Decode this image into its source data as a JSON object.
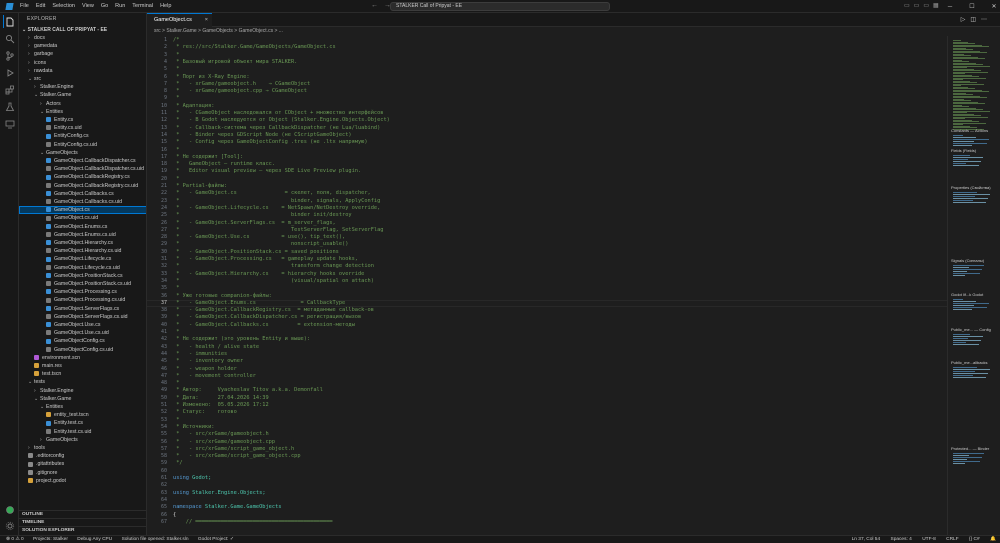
{
  "titlebar": {
    "menu": [
      "File",
      "Edit",
      "Selection",
      "View",
      "Go",
      "Run",
      "Terminal",
      "Help"
    ],
    "search": "STALKER Call of Pripyat - EE"
  },
  "sidebar": {
    "header": "EXPLORER",
    "project": "STALKER CALL OF PRIPYAT - EE",
    "tree": [
      {
        "label": "docs",
        "depth": 1,
        "kind": "folder"
      },
      {
        "label": "gamedata",
        "depth": 1,
        "kind": "folder"
      },
      {
        "label": "garbage",
        "depth": 1,
        "kind": "folder"
      },
      {
        "label": "icons",
        "depth": 1,
        "kind": "folder"
      },
      {
        "label": "rawdata",
        "depth": 1,
        "kind": "folder"
      },
      {
        "label": "src",
        "depth": 1,
        "kind": "folder-open"
      },
      {
        "label": "Stalker.Engine",
        "depth": 2,
        "kind": "folder"
      },
      {
        "label": "Stalker.Game",
        "depth": 2,
        "kind": "folder-open"
      },
      {
        "label": "Actors",
        "depth": 3,
        "kind": "folder"
      },
      {
        "label": "Entities",
        "depth": 3,
        "kind": "folder-open"
      },
      {
        "label": "Entity.cs",
        "depth": 4,
        "kind": "cs"
      },
      {
        "label": "Entity.cs.uid",
        "depth": 4,
        "kind": "uid"
      },
      {
        "label": "EntityConfig.cs",
        "depth": 4,
        "kind": "cs"
      },
      {
        "label": "EntityConfig.cs.uid",
        "depth": 4,
        "kind": "uid"
      },
      {
        "label": "GameObjects",
        "depth": 3,
        "kind": "folder-open"
      },
      {
        "label": "GameObject.CallbackDispatcher.cs",
        "depth": 4,
        "kind": "cs"
      },
      {
        "label": "GameObject.CallbackDispatcher.cs.uid",
        "depth": 4,
        "kind": "uid"
      },
      {
        "label": "GameObject.CallbackRegistry.cs",
        "depth": 4,
        "kind": "cs"
      },
      {
        "label": "GameObject.CallbackRegistry.cs.uid",
        "depth": 4,
        "kind": "uid"
      },
      {
        "label": "GameObject.Callbacks.cs",
        "depth": 4,
        "kind": "cs"
      },
      {
        "label": "GameObject.Callbacks.cs.uid",
        "depth": 4,
        "kind": "uid"
      },
      {
        "label": "GameObject.cs",
        "depth": 4,
        "kind": "cs",
        "selected": true
      },
      {
        "label": "GameObject.cs.uid",
        "depth": 4,
        "kind": "uid"
      },
      {
        "label": "GameObject.Enums.cs",
        "depth": 4,
        "kind": "cs"
      },
      {
        "label": "GameObject.Enums.cs.uid",
        "depth": 4,
        "kind": "uid"
      },
      {
        "label": "GameObject.Hierarchy.cs",
        "depth": 4,
        "kind": "cs"
      },
      {
        "label": "GameObject.Hierarchy.cs.uid",
        "depth": 4,
        "kind": "uid"
      },
      {
        "label": "GameObject.Lifecycle.cs",
        "depth": 4,
        "kind": "cs"
      },
      {
        "label": "GameObject.Lifecycle.cs.uid",
        "depth": 4,
        "kind": "uid"
      },
      {
        "label": "GameObject.PositionStack.cs",
        "depth": 4,
        "kind": "cs"
      },
      {
        "label": "GameObject.PositionStack.cs.uid",
        "depth": 4,
        "kind": "uid"
      },
      {
        "label": "GameObject.Processing.cs",
        "depth": 4,
        "kind": "cs"
      },
      {
        "label": "GameObject.Processing.cs.uid",
        "depth": 4,
        "kind": "uid"
      },
      {
        "label": "GameObject.ServerFlags.cs",
        "depth": 4,
        "kind": "cs"
      },
      {
        "label": "GameObject.ServerFlags.cs.uid",
        "depth": 4,
        "kind": "uid"
      },
      {
        "label": "GameObject.Use.cs",
        "depth": 4,
        "kind": "cs"
      },
      {
        "label": "GameObject.Use.cs.uid",
        "depth": 4,
        "kind": "uid"
      },
      {
        "label": "GameObjectConfig.cs",
        "depth": 4,
        "kind": "cs"
      },
      {
        "label": "GameObjectConfig.cs.uid",
        "depth": 4,
        "kind": "uid"
      },
      {
        "label": "environment.scn",
        "depth": 2,
        "kind": "scn"
      },
      {
        "label": "main.res",
        "depth": 2,
        "kind": "res"
      },
      {
        "label": "test.tscn",
        "depth": 2,
        "kind": "res"
      },
      {
        "label": "tests",
        "depth": 1,
        "kind": "folder-open"
      },
      {
        "label": "Stalker.Engine",
        "depth": 2,
        "kind": "folder"
      },
      {
        "label": "Stalker.Game",
        "depth": 2,
        "kind": "folder-open"
      },
      {
        "label": "Entities",
        "depth": 3,
        "kind": "folder-open"
      },
      {
        "label": "entity_test.tscn",
        "depth": 4,
        "kind": "res"
      },
      {
        "label": "Entity.test.cs",
        "depth": 4,
        "kind": "cs"
      },
      {
        "label": "Entity.test.cs.uid",
        "depth": 4,
        "kind": "uid"
      },
      {
        "label": "GameObjects",
        "depth": 3,
        "kind": "folder"
      },
      {
        "label": "tools",
        "depth": 1,
        "kind": "folder"
      },
      {
        "label": ".editorconfig",
        "depth": 1,
        "kind": "cfg"
      },
      {
        "label": ".gitattributes",
        "depth": 1,
        "kind": "cfg"
      },
      {
        "label": ".gitignore",
        "depth": 1,
        "kind": "cfg"
      },
      {
        "label": "project.godot",
        "depth": 1,
        "kind": "res"
      }
    ],
    "sections": [
      "OUTLINE",
      "TIMELINE",
      "SOLUTION EXPLORER"
    ]
  },
  "editor": {
    "tab": "GameObject.cs",
    "breadcrumb": "src > Stalker.Game > GameObjects > GameObject.cs > ...",
    "current_line": 37,
    "lines": [
      {
        "n": "1",
        "text": "/*",
        "kind": "c"
      },
      {
        "n": "2",
        "text": " * res://src/Stalker.Game/GameObjects/GameObject.cs",
        "kind": "c"
      },
      {
        "n": "3",
        "text": " *",
        "kind": "c"
      },
      {
        "n": "4",
        "text": " * Базовый игровой объект мира STALKER.",
        "kind": "c"
      },
      {
        "n": "5",
        "text": " *",
        "kind": "c"
      },
      {
        "n": "6",
        "text": " * Порт из X-Ray Engine:",
        "kind": "c"
      },
      {
        "n": "7",
        "text": " *   - xrGame/gameobject.h    → CGameObject",
        "kind": "c"
      },
      {
        "n": "8",
        "text": " *   - xrGame/gameobject.cpp → CGameObject",
        "kind": "c"
      },
      {
        "n": "9",
        "text": " *",
        "kind": "c"
      },
      {
        "n": "10",
        "text": " * Адаптация:",
        "kind": "c"
      },
      {
        "n": "11",
        "text": " *   - CGameObject наследовался от CObject + множество интерфейсов",
        "kind": "c"
      },
      {
        "n": "12",
        "text": " *   - В Godot наследуется от Object (Stalker.Engine.Objects.Object)",
        "kind": "c"
      },
      {
        "n": "13",
        "text": " *   - Callback-система через CallbackDispatcher (не Lua/luabind)",
        "kind": "c"
      },
      {
        "n": "14",
        "text": " *   - Binder через GDScript Node (не CScriptGameObject)",
        "kind": "c"
      },
      {
        "n": "15",
        "text": " *   - Config через GameObjectConfig .tres (не .ltx напрямую)",
        "kind": "c"
      },
      {
        "n": "16",
        "text": " *",
        "kind": "c"
      },
      {
        "n": "17",
        "text": " * Не содержит [Tool]:",
        "kind": "c"
      },
      {
        "n": "18",
        "text": " *   GameObject — runtime класс.",
        "kind": "c"
      },
      {
        "n": "19",
        "text": " *   Editor visual preview — через SDE Live Preview plugin.",
        "kind": "c"
      },
      {
        "n": "20",
        "text": " *",
        "kind": "c"
      },
      {
        "n": "21",
        "text": " * Partial-файлы:",
        "kind": "c"
      },
      {
        "n": "22",
        "text": " *   - GameObject.cs               = скелет, поля, dispatcher,",
        "kind": "c"
      },
      {
        "n": "23",
        "text": " *                                   binder, signals, ApplyConfig",
        "kind": "c"
      },
      {
        "n": "24",
        "text": " *   - GameObject.Lifecycle.cs    = NetSpawn/NetDestroy override,",
        "kind": "c"
      },
      {
        "n": "25",
        "text": " *                                   binder init/destroy",
        "kind": "c"
      },
      {
        "n": "26",
        "text": " *   - GameObject.ServerFlags.cs  = m_server_flags,",
        "kind": "c"
      },
      {
        "n": "27",
        "text": " *                                   TestServerFlag, SetServerFlag",
        "kind": "c"
      },
      {
        "n": "28",
        "text": " *   - GameObject.Use.cs          = use(), tip_text(),",
        "kind": "c"
      },
      {
        "n": "29",
        "text": " *                                   nonscript_usable()",
        "kind": "c"
      },
      {
        "n": "30",
        "text": " *   - GameObject.PositionStack.cs = saved positions",
        "kind": "c"
      },
      {
        "n": "31",
        "text": " *   - GameObject.Processing.cs   = gameplay update hooks,",
        "kind": "c"
      },
      {
        "n": "32",
        "text": " *                                   transform change detection",
        "kind": "c"
      },
      {
        "n": "33",
        "text": " *   - GameObject.Hierarchy.cs    = hierarchy hooks override",
        "kind": "c"
      },
      {
        "n": "34",
        "text": " *                                   (visual/spatial on attach)",
        "kind": "c"
      },
      {
        "n": "35",
        "text": " *",
        "kind": "c"
      },
      {
        "n": "36",
        "text": " * Уже готовые companion-файлы:",
        "kind": "c"
      },
      {
        "n": "37",
        "text": " *   - GameObject.Enums.cs              = CallbackType",
        "kind": "c"
      },
      {
        "n": "38",
        "text": " *   - GameObject.CallbackRegistry.cs  = метаданные callback-ов",
        "kind": "c"
      },
      {
        "n": "39",
        "text": " *   - GameObject.CallbackDispatcher.cs = регистрация/вызов",
        "kind": "c"
      },
      {
        "n": "40",
        "text": " *   - GameObject.Callbacks.cs         = extension-методы",
        "kind": "c"
      },
      {
        "n": "41",
        "text": " *",
        "kind": "c"
      },
      {
        "n": "42",
        "text": " * Не содержит (это уровень Entity и выше):",
        "kind": "c"
      },
      {
        "n": "43",
        "text": " *   - health / alive state",
        "kind": "c"
      },
      {
        "n": "44",
        "text": " *   - immunities",
        "kind": "c"
      },
      {
        "n": "45",
        "text": " *   - inventory owner",
        "kind": "c"
      },
      {
        "n": "46",
        "text": " *   - weapon holder",
        "kind": "c"
      },
      {
        "n": "47",
        "text": " *   - movement controller",
        "kind": "c"
      },
      {
        "n": "48",
        "text": " *",
        "kind": "c"
      },
      {
        "n": "49",
        "text": " * Автор:     Vyacheslav Titov a.k.a. Demonfall",
        "kind": "c"
      },
      {
        "n": "50",
        "text": " * Дата:      27.04.2026 14:39",
        "kind": "c"
      },
      {
        "n": "51",
        "text": " * Изменено:  05.05.2026 17:12",
        "kind": "c"
      },
      {
        "n": "52",
        "text": " * Статус:    готово",
        "kind": "c"
      },
      {
        "n": "53",
        "text": " *",
        "kind": "c"
      },
      {
        "n": "54",
        "text": " * Источники:",
        "kind": "c"
      },
      {
        "n": "55",
        "text": " *   - src/xrGame/gameobject.h",
        "kind": "c"
      },
      {
        "n": "56",
        "text": " *   - src/xrGame/gameobject.cpp",
        "kind": "c"
      },
      {
        "n": "57",
        "text": " *   - src/xrGame/script_game_object.h",
        "kind": "c"
      },
      {
        "n": "58",
        "text": " *   - src/xrGame/script_game_object.cpp",
        "kind": "c"
      },
      {
        "n": "59",
        "text": " */",
        "kind": "c"
      },
      {
        "n": "60",
        "text": "",
        "kind": "c"
      },
      {
        "n": "61",
        "text": "using Godot;",
        "kind": "using"
      },
      {
        "n": "62",
        "text": "",
        "kind": "c"
      },
      {
        "n": "63",
        "text": "using Stalker.Engine.Objects;",
        "kind": "using"
      },
      {
        "n": "64",
        "text": "",
        "kind": "c"
      },
      {
        "n": "65",
        "text": "namespace Stalker.Game.GameObjects",
        "kind": "ns"
      },
      {
        "n": "66",
        "text": "{",
        "kind": "p"
      },
      {
        "n": "67",
        "text": "    // ═══════════════════════════════════════════",
        "kind": "c"
      }
    ]
  },
  "minimap": {
    "labels": [
      "Constants — Actions",
      "Fields (Fields)",
      "Properties (Свойства)",
      "Signals (Сигналы)",
      "Godot lif...k Godot",
      "Public_me... — Config",
      "Public_me...allbacks",
      "Protected... — Binder"
    ]
  },
  "statusbar": {
    "left": [
      "⊗ 0 ⚠ 0",
      "Projects: Stalker",
      "Debug Any CPU",
      "Solution file opened: Stalker.sln",
      "Godot Project: ✓"
    ],
    "right": [
      "Ln 37, Col 54",
      "Spaces: 4",
      "UTF-8",
      "CRLF",
      "{} C#",
      "🔔"
    ]
  }
}
